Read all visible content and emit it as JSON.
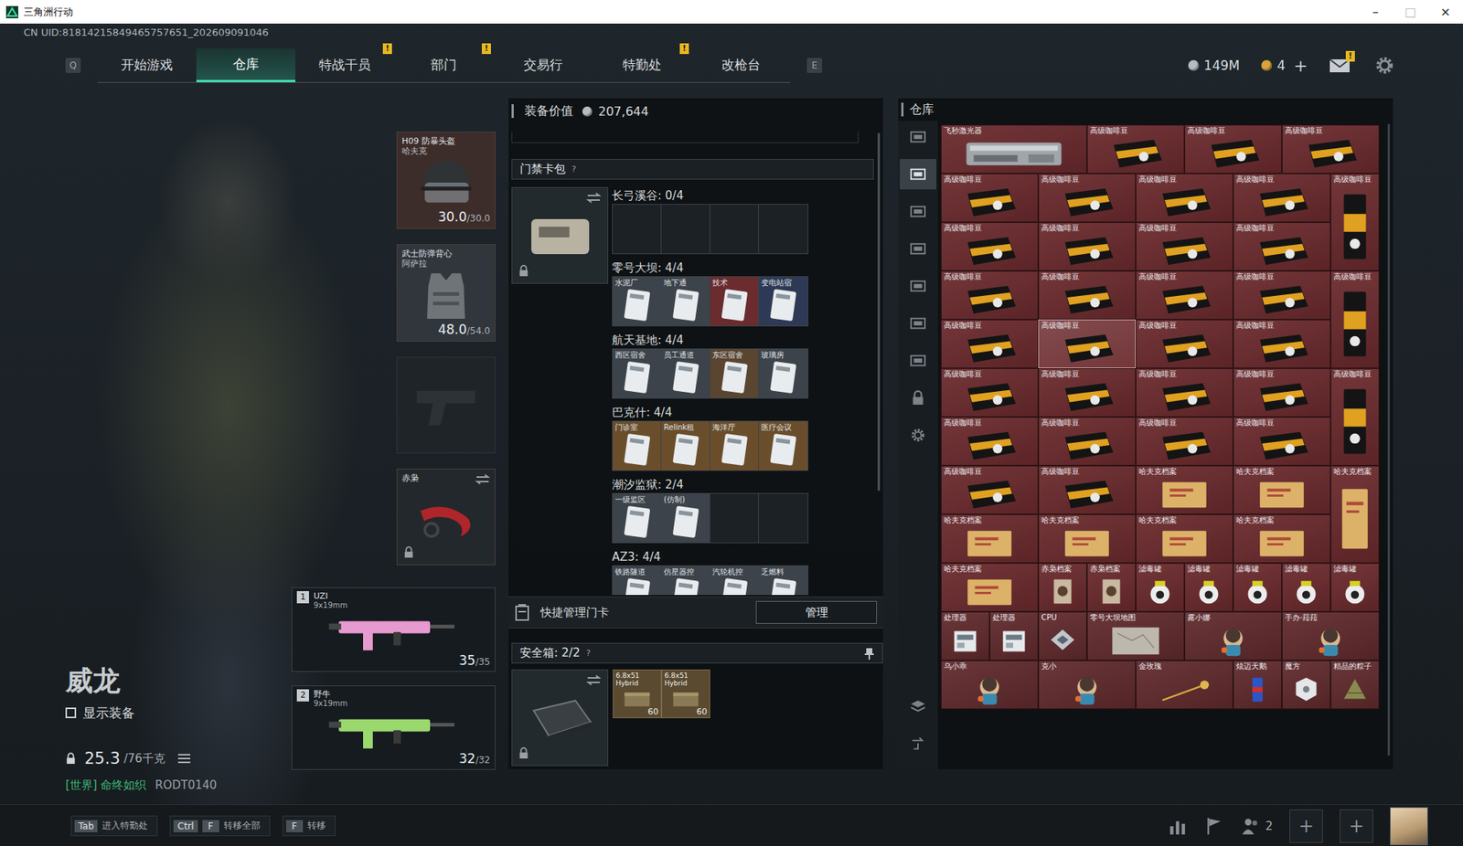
{
  "window": {
    "title": "三角洲行动",
    "controls": [
      {
        "label": "–",
        "disabled": false
      },
      {
        "label": "□",
        "disabled": true
      },
      {
        "label": "×",
        "disabled": false
      }
    ]
  },
  "uid": "CN UID:81814215849465757651_202609091046",
  "nav": {
    "left_key": "Q",
    "right_key": "E",
    "alert_mark": "!",
    "tabs": [
      {
        "label": "开始游戏",
        "selected": false,
        "alert": false
      },
      {
        "label": "仓库",
        "selected": true,
        "alert": false
      },
      {
        "label": "特战干员",
        "selected": false,
        "alert": true
      },
      {
        "label": "部门",
        "selected": false,
        "alert": true
      },
      {
        "label": "交易行",
        "selected": false,
        "alert": false
      },
      {
        "label": "特勤处",
        "selected": false,
        "alert": true
      },
      {
        "label": "改枪台",
        "selected": false,
        "alert": false
      }
    ]
  },
  "currencies": [
    {
      "amount": "149M",
      "add": "",
      "color": "#b8bcc0"
    },
    {
      "amount": "4",
      "add": "+",
      "color": "#d8a23c"
    }
  ],
  "mail": {
    "alert": true,
    "mark": "!"
  },
  "operator": {
    "name": "威龙",
    "show_gear_label": "显示装备",
    "show_gear": false,
    "weight": "25.3",
    "weight_max": "/76千克",
    "channel": "[世界]",
    "motto": "命终如织",
    "code": "RODT0140"
  },
  "gear": [
    {
      "kind": "helmet",
      "title": "H09 防暴头盔",
      "sub": "哈夫克",
      "value": "30.0",
      "max": "/30.0",
      "empty": false,
      "locked": false,
      "swap": false,
      "color": "#3d2d2a"
    },
    {
      "kind": "vest",
      "title": "武士防弹背心",
      "sub": "阿萨拉",
      "value": "48.0",
      "max": "/54.0",
      "empty": false,
      "locked": false,
      "swap": false,
      "color": "#30363c"
    },
    {
      "kind": "pistol",
      "title": "",
      "sub": "",
      "value": "",
      "max": "",
      "empty": true,
      "locked": false,
      "swap": false,
      "color": "#1f2428"
    },
    {
      "kind": "melee",
      "title": "赤枭",
      "sub": "",
      "value": "",
      "max": "",
      "empty": false,
      "locked": true,
      "swap": true,
      "color": "#23282c"
    }
  ],
  "weapons": [
    {
      "slot": "1",
      "name": "UZI",
      "caliber": "9x19mm",
      "ammo": "35",
      "max": "/35",
      "color": "#e79ad0"
    },
    {
      "slot": "2",
      "name": "野牛",
      "caliber": "9x19mm",
      "ammo": "32",
      "max": "/32",
      "color": "#9bd86e"
    }
  ],
  "loadout_value": {
    "label": "装备价值",
    "value": "207,644"
  },
  "keycards": {
    "title": "门禁卡包",
    "help": "?",
    "locked": true,
    "swap": true,
    "sections": [
      {
        "name": "长弓溪谷",
        "count": "0/4",
        "slots": [
          {
            "label": "",
            "filled": false,
            "color": "#1c2125"
          },
          {
            "label": "",
            "filled": false,
            "color": "#1c2125"
          },
          {
            "label": "",
            "filled": false,
            "color": "#1c2125"
          },
          {
            "label": "",
            "filled": false,
            "color": "#1c2125"
          }
        ]
      },
      {
        "name": "零号大坝",
        "count": "4/4",
        "slots": [
          {
            "label": "水泥厂",
            "filled": true,
            "color": "#3c434a"
          },
          {
            "label": "地下通",
            "filled": true,
            "color": "#3c434a"
          },
          {
            "label": "技术",
            "filled": true,
            "color": "#6a2c2e"
          },
          {
            "label": "变电站宿",
            "filled": true,
            "color": "#2e3a55"
          }
        ]
      },
      {
        "name": "航天基地",
        "count": "4/4",
        "slots": [
          {
            "label": "西区宿舍",
            "filled": true,
            "color": "#3c434a"
          },
          {
            "label": "员工通道",
            "filled": true,
            "color": "#3c434a"
          },
          {
            "label": "东区宿舍",
            "filled": true,
            "color": "#5a4530"
          },
          {
            "label": "玻璃房",
            "filled": true,
            "color": "#3c434a"
          }
        ]
      },
      {
        "name": "巴克什",
        "count": "4/4",
        "slots": [
          {
            "label": "门诊室",
            "filled": true,
            "color": "#6a4e2c"
          },
          {
            "label": "Relink租",
            "filled": true,
            "color": "#6a4e2c"
          },
          {
            "label": "海洋厅",
            "filled": true,
            "color": "#6a4e2c"
          },
          {
            "label": "医疗会议",
            "filled": true,
            "color": "#6a4e2c"
          }
        ]
      },
      {
        "name": "潮汐监狱",
        "count": "2/4",
        "slots": [
          {
            "label": "一级监区",
            "filled": true,
            "color": "#3c434a"
          },
          {
            "label": "(仿制)",
            "filled": true,
            "color": "#3c434a"
          },
          {
            "label": "",
            "filled": false,
            "color": "#1c2125"
          },
          {
            "label": "",
            "filled": false,
            "color": "#1c2125"
          }
        ]
      },
      {
        "name": "AZ3",
        "count": "4/4",
        "slots": [
          {
            "label": "铁路隧道",
            "filled": true,
            "color": "#3c434a"
          },
          {
            "label": "仿星器控",
            "filled": true,
            "color": "#3c434a"
          },
          {
            "label": "汽轮机控",
            "filled": true,
            "color": "#3c434a"
          },
          {
            "label": "乏燃料",
            "filled": true,
            "color": "#3c434a"
          }
        ]
      }
    ]
  },
  "quick_manage": {
    "label": "快捷管理门卡",
    "button": "管理"
  },
  "safebox": {
    "label": "安全箱:",
    "count": "2/2",
    "help": "?",
    "locked": true,
    "swap": true,
    "items": [
      {
        "name": "6.8x51 Hybrid",
        "count": "60"
      },
      {
        "name": "6.8x51 Hybrid",
        "count": "60"
      }
    ]
  },
  "stash": {
    "title": "仓库",
    "tabs": [
      {
        "kind": "box",
        "selected": false
      },
      {
        "kind": "box",
        "selected": true
      },
      {
        "kind": "box",
        "selected": false
      },
      {
        "kind": "box",
        "selected": false
      },
      {
        "kind": "box",
        "selected": false
      },
      {
        "kind": "box",
        "selected": false
      },
      {
        "kind": "box",
        "selected": false
      },
      {
        "kind": "lock",
        "selected": false
      },
      {
        "kind": "settings",
        "selected": false
      }
    ],
    "tools": [
      {
        "kind": "layers"
      },
      {
        "kind": "transfer"
      }
    ],
    "items": [
      {
        "name": "飞秒激光器",
        "kind": "laser",
        "color": "#6b2a2d",
        "selected": false
      },
      {
        "name": "高级咖啡豆",
        "kind": "coffee",
        "color": "#6b2a2d",
        "selected": false
      },
      {
        "name": "高级咖啡豆",
        "kind": "coffee",
        "color": "#6b2a2d",
        "selected": false
      },
      {
        "name": "高级咖啡豆",
        "kind": "coffee",
        "color": "#6b2a2d",
        "selected": false
      },
      {
        "name": "高级咖啡豆",
        "kind": "coffee",
        "color": "#6b2a2d",
        "selected": false
      },
      {
        "name": "高级咖啡豆",
        "kind": "coffee",
        "color": "#6b2a2d",
        "selected": false
      },
      {
        "name": "高级咖啡豆",
        "kind": "coffee",
        "color": "#6b2a2d",
        "selected": false
      },
      {
        "name": "高级咖啡豆",
        "kind": "coffee",
        "color": "#6b2a2d",
        "selected": false
      },
      {
        "name": "高级咖啡豆",
        "kind": "bag",
        "color": "#6b2a2d",
        "selected": false
      },
      {
        "name": "高级咖啡豆",
        "kind": "coffee",
        "color": "#6b2a2d",
        "selected": false
      },
      {
        "name": "高级咖啡豆",
        "kind": "coffee",
        "color": "#6b2a2d",
        "selected": false
      },
      {
        "name": "高级咖啡豆",
        "kind": "coffee",
        "color": "#6b2a2d",
        "selected": false
      },
      {
        "name": "高级咖啡豆",
        "kind": "coffee",
        "color": "#6b2a2d",
        "selected": false
      },
      {
        "name": "高级咖啡豆",
        "kind": "coffee",
        "color": "#6b2a2d",
        "selected": false
      },
      {
        "name": "高级咖啡豆",
        "kind": "coffee",
        "color": "#6b2a2d",
        "selected": false
      },
      {
        "name": "高级咖啡豆",
        "kind": "coffee",
        "color": "#6b2a2d",
        "selected": false
      },
      {
        "name": "高级咖啡豆",
        "kind": "coffee",
        "color": "#6b2a2d",
        "selected": false
      },
      {
        "name": "高级咖啡豆",
        "kind": "bag",
        "color": "#6b2a2d",
        "selected": false
      },
      {
        "name": "高级咖啡豆",
        "kind": "coffee",
        "color": "#6b2a2d",
        "selected": false
      },
      {
        "name": "高级咖啡豆",
        "kind": "coffee",
        "color": "#6b2a2d",
        "selected": true
      },
      {
        "name": "高级咖啡豆",
        "kind": "coffee",
        "color": "#6b2a2d",
        "selected": false
      },
      {
        "name": "高级咖啡豆",
        "kind": "coffee",
        "color": "#6b2a2d",
        "selected": false
      },
      {
        "name": "高级咖啡豆",
        "kind": "coffee",
        "color": "#6b2a2d",
        "selected": false
      },
      {
        "name": "高级咖啡豆",
        "kind": "coffee",
        "color": "#6b2a2d",
        "selected": false
      },
      {
        "name": "高级咖啡豆",
        "kind": "coffee",
        "color": "#6b2a2d",
        "selected": false
      },
      {
        "name": "高级咖啡豆",
        "kind": "coffee",
        "color": "#6b2a2d",
        "selected": false
      },
      {
        "name": "高级咖啡豆",
        "kind": "bag",
        "color": "#6b2a2d",
        "selected": false
      },
      {
        "name": "高级咖啡豆",
        "kind": "coffee",
        "color": "#6b2a2d",
        "selected": false
      },
      {
        "name": "高级咖啡豆",
        "kind": "coffee",
        "color": "#6b2a2d",
        "selected": false
      },
      {
        "name": "高级咖啡豆",
        "kind": "coffee",
        "color": "#6b2a2d",
        "selected": false
      },
      {
        "name": "高级咖啡豆",
        "kind": "coffee",
        "color": "#6b2a2d",
        "selected": false
      },
      {
        "name": "高级咖啡豆",
        "kind": "coffee",
        "color": "#6b2a2d",
        "selected": false
      },
      {
        "name": "高级咖啡豆",
        "kind": "coffee",
        "color": "#6b2a2d",
        "selected": false
      },
      {
        "name": "哈夫克档案",
        "kind": "file",
        "color": "#6b2a2d",
        "selected": false
      },
      {
        "name": "哈夫克档案",
        "kind": "file",
        "color": "#6b2a2d",
        "selected": false
      },
      {
        "name": "哈夫克档案",
        "kind": "file-tall",
        "color": "#6b2a2d",
        "selected": false
      },
      {
        "name": "哈夫克档案",
        "kind": "file",
        "color": "#6b2a2d",
        "selected": false
      },
      {
        "name": "哈夫克档案",
        "kind": "file",
        "color": "#6b2a2d",
        "selected": false
      },
      {
        "name": "哈夫克档案",
        "kind": "file",
        "color": "#6b2a2d",
        "selected": false
      },
      {
        "name": "哈夫克档案",
        "kind": "file",
        "color": "#6b2a2d",
        "selected": false
      },
      {
        "name": "哈夫克档案",
        "kind": "file",
        "color": "#6b2a2d",
        "selected": false
      },
      {
        "name": "赤枭档案",
        "kind": "dossier",
        "color": "#6b2a2d",
        "selected": false
      },
      {
        "name": "赤枭档案",
        "kind": "dossier",
        "color": "#6b2a2d",
        "selected": false
      },
      {
        "name": "滤毒罐",
        "kind": "canister",
        "color": "#6b2a2d",
        "selected": false
      },
      {
        "name": "滤毒罐",
        "kind": "canister",
        "color": "#6b2a2d",
        "selected": false
      },
      {
        "name": "滤毒罐",
        "kind": "canister",
        "color": "#6b2a2d",
        "selected": false
      },
      {
        "name": "滤毒罐",
        "kind": "canister",
        "color": "#6b2a2d",
        "selected": false
      },
      {
        "name": "滤毒罐",
        "kind": "canister",
        "color": "#6b2a2d",
        "selected": false
      },
      {
        "name": "处理器",
        "kind": "cpu-box",
        "color": "#612a2d",
        "selected": false
      },
      {
        "name": "处理器",
        "kind": "cpu-box",
        "color": "#612a2d",
        "selected": false
      },
      {
        "name": "CPU",
        "kind": "chip",
        "color": "#612a2d",
        "selected": false
      },
      {
        "name": "零号大坝地图",
        "kind": "map",
        "color": "#612a2d",
        "selected": false
      },
      {
        "name": "露小娜",
        "kind": "figure",
        "color": "#612a2d",
        "selected": false
      },
      {
        "name": "手办·菈菈",
        "kind": "figure",
        "color": "#612a2d",
        "selected": false
      },
      {
        "name": "乌小乖",
        "kind": "figure",
        "color": "#612a2d",
        "selected": false
      },
      {
        "name": "克小",
        "kind": "figure",
        "color": "#612a2d",
        "selected": false
      },
      {
        "name": "金玫瑰",
        "kind": "rose",
        "color": "#612a2d",
        "selected": false
      },
      {
        "name": "炫迈天鹅",
        "kind": "can",
        "color": "#612a2d",
        "selected": false
      },
      {
        "name": "魔方",
        "kind": "cube",
        "color": "#612a2d",
        "selected": false
      },
      {
        "name": "精品的粽子",
        "kind": "zongzi",
        "color": "#612a2d",
        "selected": false
      }
    ]
  },
  "bottom": {
    "hints": [
      {
        "keys": [
          "Tab"
        ],
        "label": "进入特勤处"
      },
      {
        "keys": [
          "Ctrl",
          "F"
        ],
        "label": "转移全部"
      },
      {
        "keys": [
          "F"
        ],
        "label": "转移"
      }
    ],
    "squad_count": "2",
    "invite_slots": [
      "+",
      "+"
    ]
  }
}
